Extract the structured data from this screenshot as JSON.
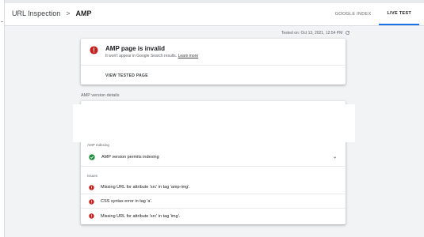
{
  "header": {
    "breadcrumb_root": "URL Inspection",
    "breadcrumb_separator": ">",
    "breadcrumb_current": "AMP",
    "tabs": [
      {
        "label": "GOOGLE INDEX",
        "active": false
      },
      {
        "label": "LIVE TEST",
        "active": true
      }
    ]
  },
  "tested": {
    "text": "Tested on: Oct 13, 2021, 12:54 PM",
    "refresh_icon": "refresh-icon"
  },
  "status_card": {
    "icon": "error-icon",
    "title": "AMP page is invalid",
    "subtitle": "It won't appear in Google Search results.",
    "learn_more": "Learn more",
    "view_button": "VIEW TESTED PAGE"
  },
  "details": {
    "section_label": "AMP version details",
    "indexing_label": "AMP Indexing",
    "indexing_status": "AMP version permits indexing",
    "indexing_icon": "check-circle-icon",
    "issues_label": "Issues",
    "issues": [
      "Missing URL for attribute 'src' in tag 'amp-img'.",
      "CSS syntax error in tag 'a'.",
      "Missing URL for attribute 'src' in tag 'img'."
    ]
  },
  "colors": {
    "error": "#c5221f",
    "success": "#1e8e3e",
    "accent": "#1a73e8"
  }
}
